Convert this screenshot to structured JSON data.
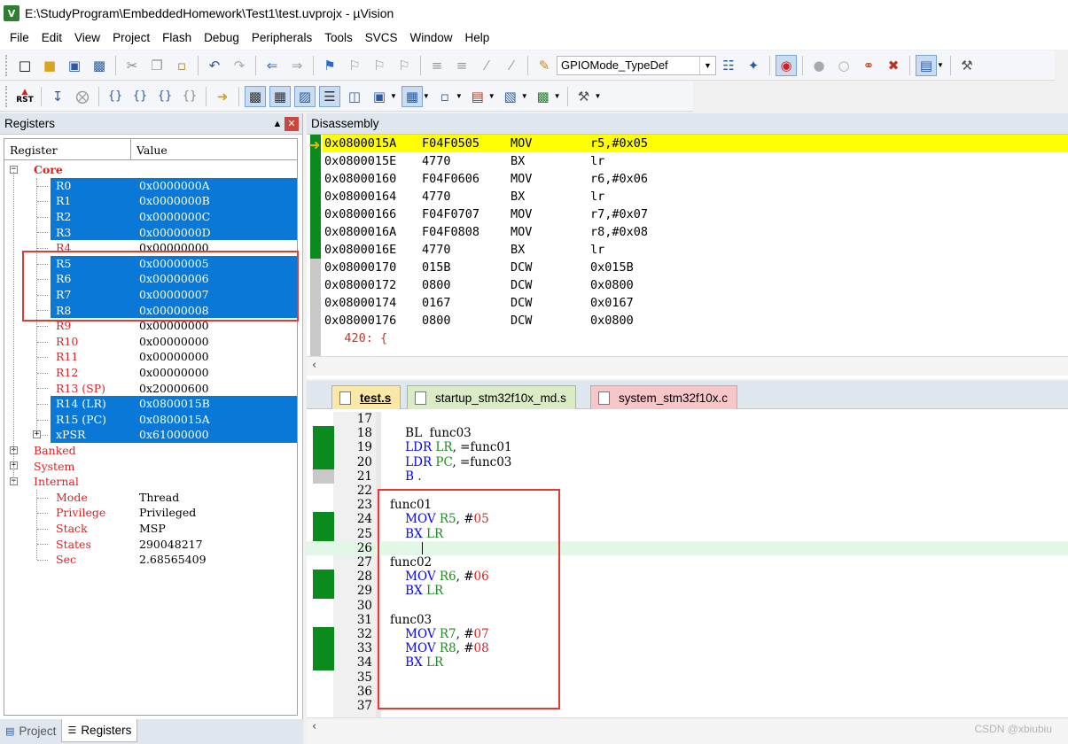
{
  "window": {
    "title": "E:\\StudyProgram\\EmbeddedHomework\\Test1\\test.uvprojx - µVision",
    "icon": "V"
  },
  "menu": [
    "File",
    "Edit",
    "View",
    "Project",
    "Flash",
    "Debug",
    "Peripherals",
    "Tools",
    "SVCS",
    "Window",
    "Help"
  ],
  "toolbar": {
    "combo_value": "GPIOMode_TypeDef",
    "rst_label": "RST"
  },
  "registers": {
    "title": "Registers",
    "col_register": "Register",
    "col_value": "Value",
    "groups": {
      "core": "Core",
      "banked": "Banked",
      "system": "System",
      "internal": "Internal"
    },
    "core": [
      {
        "name": "R0",
        "value": "0x0000000A",
        "selected": true
      },
      {
        "name": "R1",
        "value": "0x0000000B",
        "selected": true
      },
      {
        "name": "R2",
        "value": "0x0000000C",
        "selected": true
      },
      {
        "name": "R3",
        "value": "0x0000000D",
        "selected": true
      },
      {
        "name": "R4",
        "value": "0x00000000",
        "selected": false
      },
      {
        "name": "R5",
        "value": "0x00000005",
        "selected": true
      },
      {
        "name": "R6",
        "value": "0x00000006",
        "selected": true
      },
      {
        "name": "R7",
        "value": "0x00000007",
        "selected": true
      },
      {
        "name": "R8",
        "value": "0x00000008",
        "selected": true
      },
      {
        "name": "R9",
        "value": "0x00000000",
        "selected": false
      },
      {
        "name": "R10",
        "value": "0x00000000",
        "selected": false
      },
      {
        "name": "R11",
        "value": "0x00000000",
        "selected": false
      },
      {
        "name": "R12",
        "value": "0x00000000",
        "selected": false
      },
      {
        "name": "R13 (SP)",
        "value": "0x20000600",
        "selected": false
      },
      {
        "name": "R14 (LR)",
        "value": "0x0800015B",
        "selected": true
      },
      {
        "name": "R15 (PC)",
        "value": "0x0800015A",
        "selected": true
      },
      {
        "name": "xPSR",
        "value": "0x61000000",
        "selected": true
      }
    ],
    "internal": [
      {
        "name": "Mode",
        "value": "Thread"
      },
      {
        "name": "Privilege",
        "value": "Privileged"
      },
      {
        "name": "Stack",
        "value": "MSP"
      },
      {
        "name": "States",
        "value": "290048217"
      },
      {
        "name": "Sec",
        "value": "2.68565409"
      }
    ]
  },
  "bottom_tabs": {
    "project": "Project",
    "registers": "Registers"
  },
  "disassembly": {
    "title": "Disassembly",
    "rows": [
      {
        "addr": "0x0800015A",
        "code": "F04F0505",
        "mn": "MOV",
        "op": "r5,#0x05",
        "current": true
      },
      {
        "addr": "0x0800015E",
        "code": "4770",
        "mn": "BX",
        "op": "lr",
        "current": false
      },
      {
        "addr": "0x08000160",
        "code": "F04F0606",
        "mn": "MOV",
        "op": "r6,#0x06",
        "current": false
      },
      {
        "addr": "0x08000164",
        "code": "4770",
        "mn": "BX",
        "op": "lr",
        "current": false
      },
      {
        "addr": "0x08000166",
        "code": "F04F0707",
        "mn": "MOV",
        "op": "r7,#0x07",
        "current": false
      },
      {
        "addr": "0x0800016A",
        "code": "F04F0808",
        "mn": "MOV",
        "op": "r8,#0x08",
        "current": false
      },
      {
        "addr": "0x0800016E",
        "code": "4770",
        "mn": "BX",
        "op": "lr",
        "current": false
      },
      {
        "addr": "0x08000170",
        "code": "015B",
        "mn": "DCW",
        "op": "0x015B",
        "current": false
      },
      {
        "addr": "0x08000172",
        "code": "0800",
        "mn": "DCW",
        "op": "0x0800",
        "current": false
      },
      {
        "addr": "0x08000174",
        "code": "0167",
        "mn": "DCW",
        "op": "0x0167",
        "current": false
      },
      {
        "addr": "0x08000176",
        "code": "0800",
        "mn": "DCW",
        "op": "0x0800",
        "current": false
      }
    ],
    "source_line": "   420: {"
  },
  "editor": {
    "tabs": [
      {
        "label": "test.s",
        "color": "#fbe7a6",
        "active": true
      },
      {
        "label": "startup_stm32f10x_md.s",
        "color": "#d9ecc6",
        "active": false
      },
      {
        "label": "system_stm32f10x.c",
        "color": "#f7c6c6",
        "active": false
      }
    ],
    "lines": [
      {
        "n": "17",
        "parts": [],
        "mark": "none"
      },
      {
        "n": "18",
        "parts": [
          {
            "t": "    BL  func03",
            "c": ""
          }
        ],
        "mark": "green"
      },
      {
        "n": "19",
        "parts": [
          {
            "t": "    LDR ",
            "c": "kw"
          },
          {
            "t": "LR",
            "c": "rg"
          },
          {
            "t": ", =func01",
            "c": ""
          }
        ],
        "mark": "green"
      },
      {
        "n": "20",
        "parts": [
          {
            "t": "    LDR ",
            "c": "kw"
          },
          {
            "t": "PC",
            "c": "rg"
          },
          {
            "t": ", =func03",
            "c": ""
          }
        ],
        "mark": "green"
      },
      {
        "n": "21",
        "parts": [
          {
            "t": "    B .",
            "c": "kw"
          }
        ],
        "mark": "gray"
      },
      {
        "n": "22",
        "parts": [],
        "mark": "none"
      },
      {
        "n": "23",
        "parts": [
          {
            "t": "func01",
            "c": ""
          }
        ],
        "mark": "none"
      },
      {
        "n": "24",
        "parts": [
          {
            "t": "    MOV ",
            "c": "kw"
          },
          {
            "t": "R5",
            "c": "rg"
          },
          {
            "t": ", #",
            "c": ""
          },
          {
            "t": "05",
            "c": "nm"
          }
        ],
        "mark": "green"
      },
      {
        "n": "25",
        "parts": [
          {
            "t": "    BX ",
            "c": "kw"
          },
          {
            "t": "LR",
            "c": "rg"
          }
        ],
        "mark": "green"
      },
      {
        "n": "26",
        "parts": [],
        "mark": "none",
        "caret": true
      },
      {
        "n": "27",
        "parts": [
          {
            "t": "func02",
            "c": ""
          }
        ],
        "mark": "none"
      },
      {
        "n": "28",
        "parts": [
          {
            "t": "    MOV ",
            "c": "kw"
          },
          {
            "t": "R6",
            "c": "rg"
          },
          {
            "t": ", #",
            "c": ""
          },
          {
            "t": "06",
            "c": "nm"
          }
        ],
        "mark": "green"
      },
      {
        "n": "29",
        "parts": [
          {
            "t": "    BX ",
            "c": "kw"
          },
          {
            "t": "LR",
            "c": "rg"
          }
        ],
        "mark": "green"
      },
      {
        "n": "30",
        "parts": [],
        "mark": "none"
      },
      {
        "n": "31",
        "parts": [
          {
            "t": "func03",
            "c": ""
          }
        ],
        "mark": "none"
      },
      {
        "n": "32",
        "parts": [
          {
            "t": "    MOV ",
            "c": "kw"
          },
          {
            "t": "R7",
            "c": "rg"
          },
          {
            "t": ", #",
            "c": ""
          },
          {
            "t": "07",
            "c": "nm"
          }
        ],
        "mark": "green"
      },
      {
        "n": "33",
        "parts": [
          {
            "t": "    MOV ",
            "c": "kw"
          },
          {
            "t": "R8",
            "c": "rg"
          },
          {
            "t": ", #",
            "c": ""
          },
          {
            "t": "08",
            "c": "nm"
          }
        ],
        "mark": "green"
      },
      {
        "n": "34",
        "parts": [
          {
            "t": "    BX ",
            "c": "kw"
          },
          {
            "t": "LR",
            "c": "rg"
          }
        ],
        "mark": "green"
      },
      {
        "n": "35",
        "parts": [],
        "mark": "none"
      },
      {
        "n": "36",
        "parts": [],
        "mark": "none"
      },
      {
        "n": "37",
        "parts": [],
        "mark": "none"
      }
    ]
  },
  "watermark": "CSDN @xbiubiu",
  "colors": {
    "selection": "#0a78d7",
    "current_line": "#ffff00",
    "coverage_green": "#0b8a1e",
    "annotation_red": "#e53935"
  }
}
